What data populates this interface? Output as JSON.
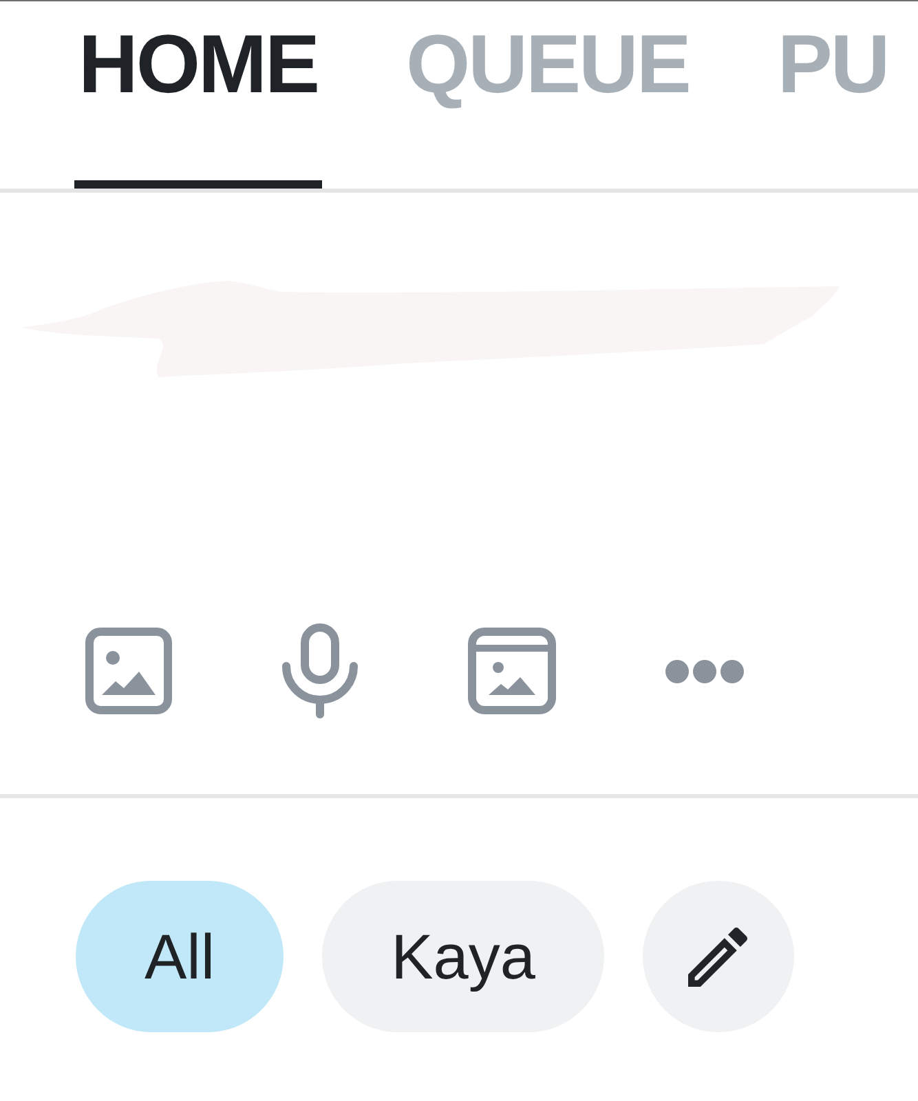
{
  "tabs": [
    {
      "label": "HOME",
      "selected": true
    },
    {
      "label": "QUEUE",
      "selected": false
    },
    {
      "label": "PU",
      "selected": false
    }
  ],
  "composer": {
    "tools": [
      {
        "kind": "image"
      },
      {
        "kind": "microphone"
      },
      {
        "kind": "album"
      },
      {
        "kind": "more"
      }
    ]
  },
  "filters": [
    {
      "label": "All",
      "selected": true
    },
    {
      "label": "Kaya",
      "selected": false
    }
  ]
}
